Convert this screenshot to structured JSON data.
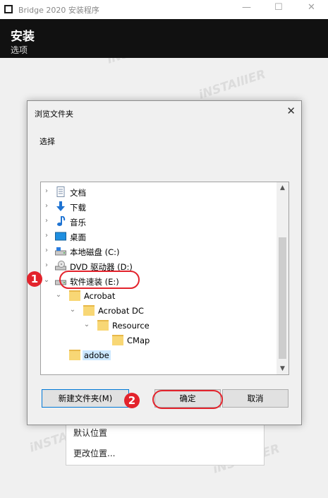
{
  "window": {
    "title": "Bridge 2020 安装程序",
    "header_title": "安装",
    "header_subtitle": "选项",
    "minimize_glyph": "—",
    "maximize_glyph": "☐",
    "close_glyph": "✕"
  },
  "options_panel": {
    "items": [
      "默认位置",
      "更改位置..."
    ]
  },
  "dialog": {
    "title": "浏览文件夹",
    "close_glyph": "✕",
    "prompt": "选择",
    "tree": [
      {
        "label": "文档",
        "icon": "documents-icon",
        "expander": "›"
      },
      {
        "label": "下载",
        "icon": "download-icon",
        "expander": "›"
      },
      {
        "label": "音乐",
        "icon": "music-icon",
        "expander": "›"
      },
      {
        "label": "桌面",
        "icon": "desktop-icon",
        "expander": "›"
      },
      {
        "label": "本地磁盘 (C:)",
        "icon": "local-disk-icon",
        "expander": "›"
      },
      {
        "label": "DVD 驱动器 (D:)",
        "icon": "dvd-drive-icon",
        "expander": "›"
      },
      {
        "label": "软件速装 (E:)",
        "icon": "drive-icon",
        "expander": "⌄"
      },
      {
        "label": "Acrobat",
        "icon": "folder-icon",
        "expander": "⌄"
      },
      {
        "label": "Acrobat DC",
        "icon": "folder-icon",
        "expander": "⌄"
      },
      {
        "label": "Resource",
        "icon": "folder-icon",
        "expander": "⌄"
      },
      {
        "label": "CMap",
        "icon": "folder-icon",
        "expander": ""
      },
      {
        "label": "adobe",
        "icon": "folder-icon",
        "expander": ""
      }
    ],
    "buttons": {
      "new_folder": "新建文件夹(M)",
      "ok": "确定",
      "cancel": "取消"
    }
  },
  "annotations": {
    "step1": "1",
    "step2": "2"
  },
  "colors": {
    "accent_red": "#e3232c",
    "header_bg": "#111111",
    "selection": "#cce8ff",
    "focus_border": "#0078d7"
  }
}
